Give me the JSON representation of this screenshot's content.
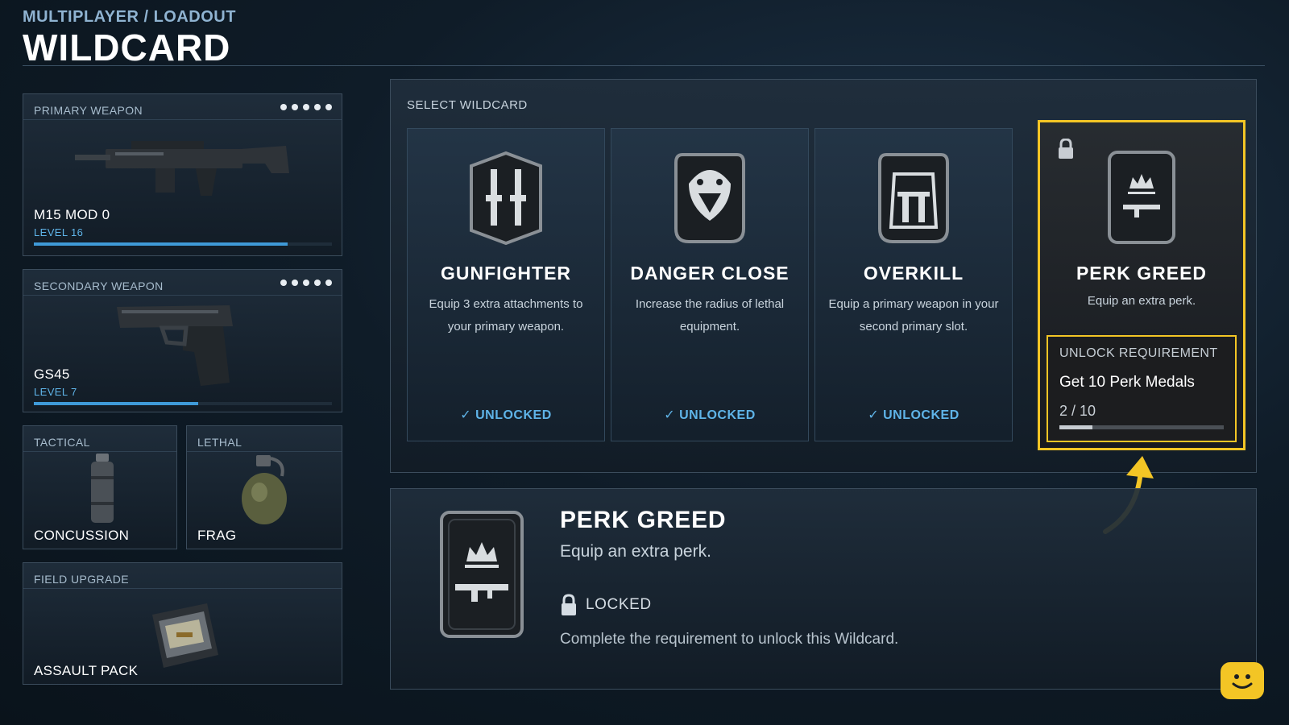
{
  "header": {
    "breadcrumb": "MULTIPLAYER / LOADOUT",
    "title": "WILDCARD"
  },
  "loadout": {
    "primary": {
      "label": "PRIMARY WEAPON",
      "name": "M15 MOD 0",
      "level": "LEVEL 16",
      "xp_fraction": 0.85,
      "icon": "assault-rifle-icon"
    },
    "secondary": {
      "label": "SECONDARY WEAPON",
      "name": "GS45",
      "level": "LEVEL 7",
      "xp_fraction": 0.55,
      "icon": "pistol-icon"
    },
    "tactical": {
      "label": "TACTICAL",
      "name": "CONCUSSION",
      "icon": "concussion-grenade-icon"
    },
    "lethal": {
      "label": "LETHAL",
      "name": "FRAG",
      "icon": "frag-grenade-icon"
    },
    "field_upgrade": {
      "label": "FIELD UPGRADE",
      "name": "ASSAULT PACK",
      "icon": "assault-pack-icon"
    }
  },
  "selector": {
    "label": "SELECT WILDCARD",
    "cards": [
      {
        "name": "GUNFIGHTER",
        "description": "Equip 3 extra attachments to your primary weapon.",
        "status": "✓ UNLOCKED",
        "icon": "gunfighter-icon"
      },
      {
        "name": "DANGER CLOSE",
        "description": "Increase the radius of lethal equipment.",
        "status": "✓ UNLOCKED",
        "icon": "snake-icon"
      },
      {
        "name": "OVERKILL",
        "description": "Equip a primary weapon in your second primary slot.",
        "status": "✓ UNLOCKED",
        "icon": "overkill-icon"
      },
      {
        "name": "PERK GREED",
        "description": "Equip an extra perk.",
        "icon": "perk-greed-icon"
      }
    ],
    "unlock": {
      "title": "UNLOCK REQUIREMENT",
      "requirement": "Get 10 Perk Medals",
      "progress_text": "2 / 10",
      "progress_fraction": 0.2
    }
  },
  "detail": {
    "name": "PERK GREED",
    "description": "Equip an extra perk.",
    "lock_status": "LOCKED",
    "note": "Complete the requirement to unlock this Wildcard."
  },
  "colors": {
    "accent_yellow": "#f3c525",
    "unlocked_blue": "#5fb4e8",
    "xp_blue": "#3f9ad8"
  }
}
